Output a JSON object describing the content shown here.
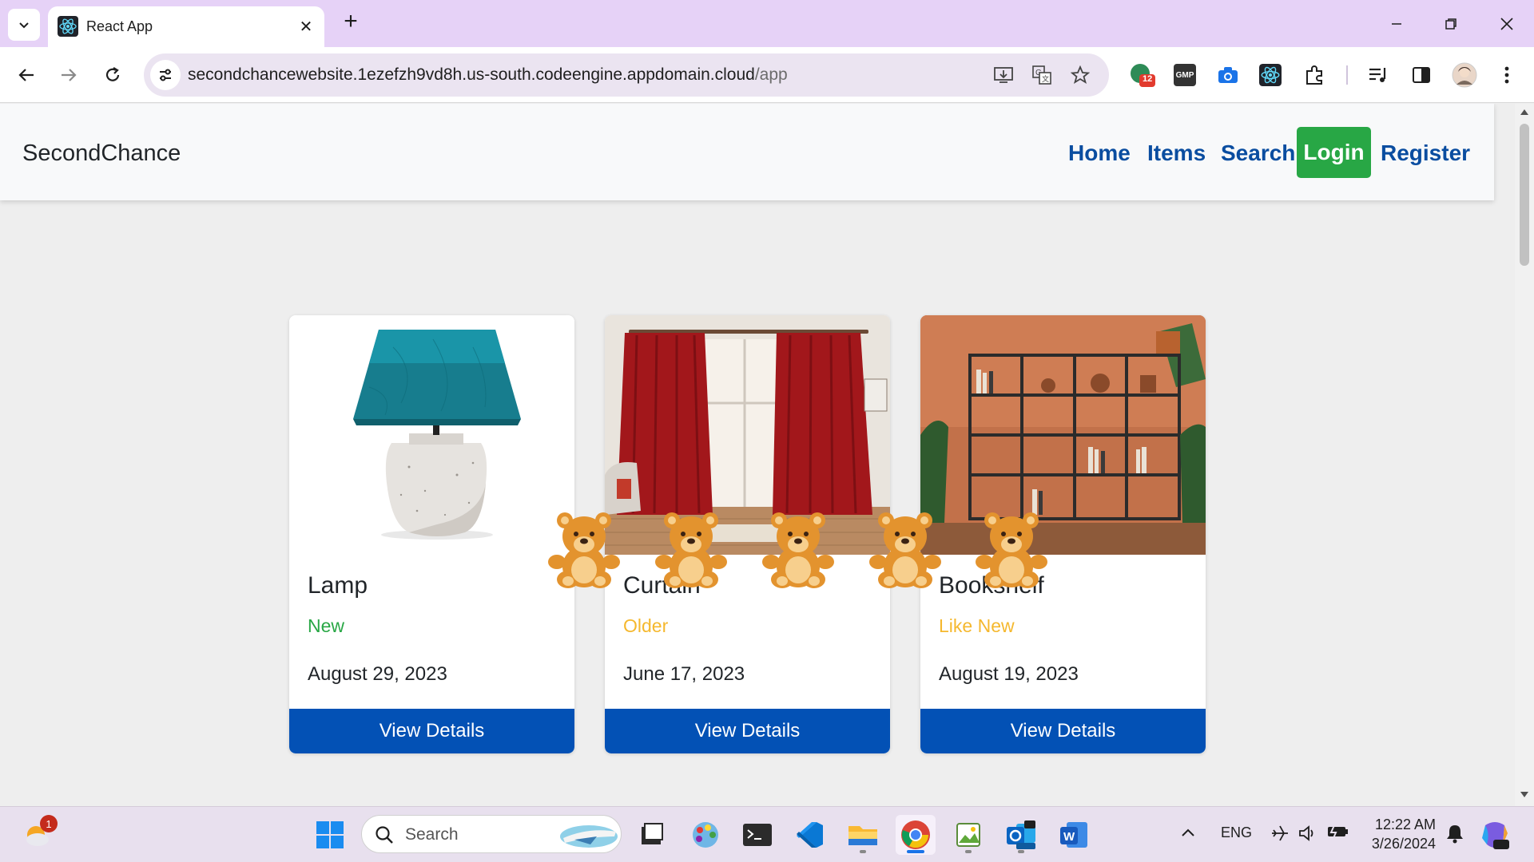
{
  "browser": {
    "tab_title": "React App",
    "url_host": "secondchancewebsite.1ezefzh9vd8h.us-south.codeengine.appdomain.cloud",
    "url_path": "/app",
    "extension_badge": "12",
    "gmp_label": "GMP"
  },
  "navbar": {
    "brand": "SecondChance",
    "links": [
      {
        "label": "Home"
      },
      {
        "label": "Items"
      },
      {
        "label": "Search"
      },
      {
        "label": "Login"
      },
      {
        "label": "Register"
      }
    ],
    "colors": {
      "link": "#0a4da0",
      "login_bg": "#28a745"
    }
  },
  "items": [
    {
      "name": "Lamp",
      "condition": "New",
      "condition_color": "#28a745",
      "date": "August 29, 2023",
      "button": "View Details"
    },
    {
      "name": "Curtain",
      "condition": "Older",
      "condition_color": "#f5b82e",
      "date": "June 17, 2023",
      "button": "View Details"
    },
    {
      "name": "Bookshelf",
      "condition": "Like New",
      "condition_color": "#f5b82e",
      "date": "August 19, 2023",
      "button": "View Details"
    }
  ],
  "decorations": {
    "bear_icon": "teddy-bear-icon",
    "bear_count": 5
  },
  "taskbar": {
    "search_label": "Search",
    "notification_badge": "1",
    "language": "ENG",
    "time": "12:22 AM",
    "date": "3/26/2024"
  }
}
